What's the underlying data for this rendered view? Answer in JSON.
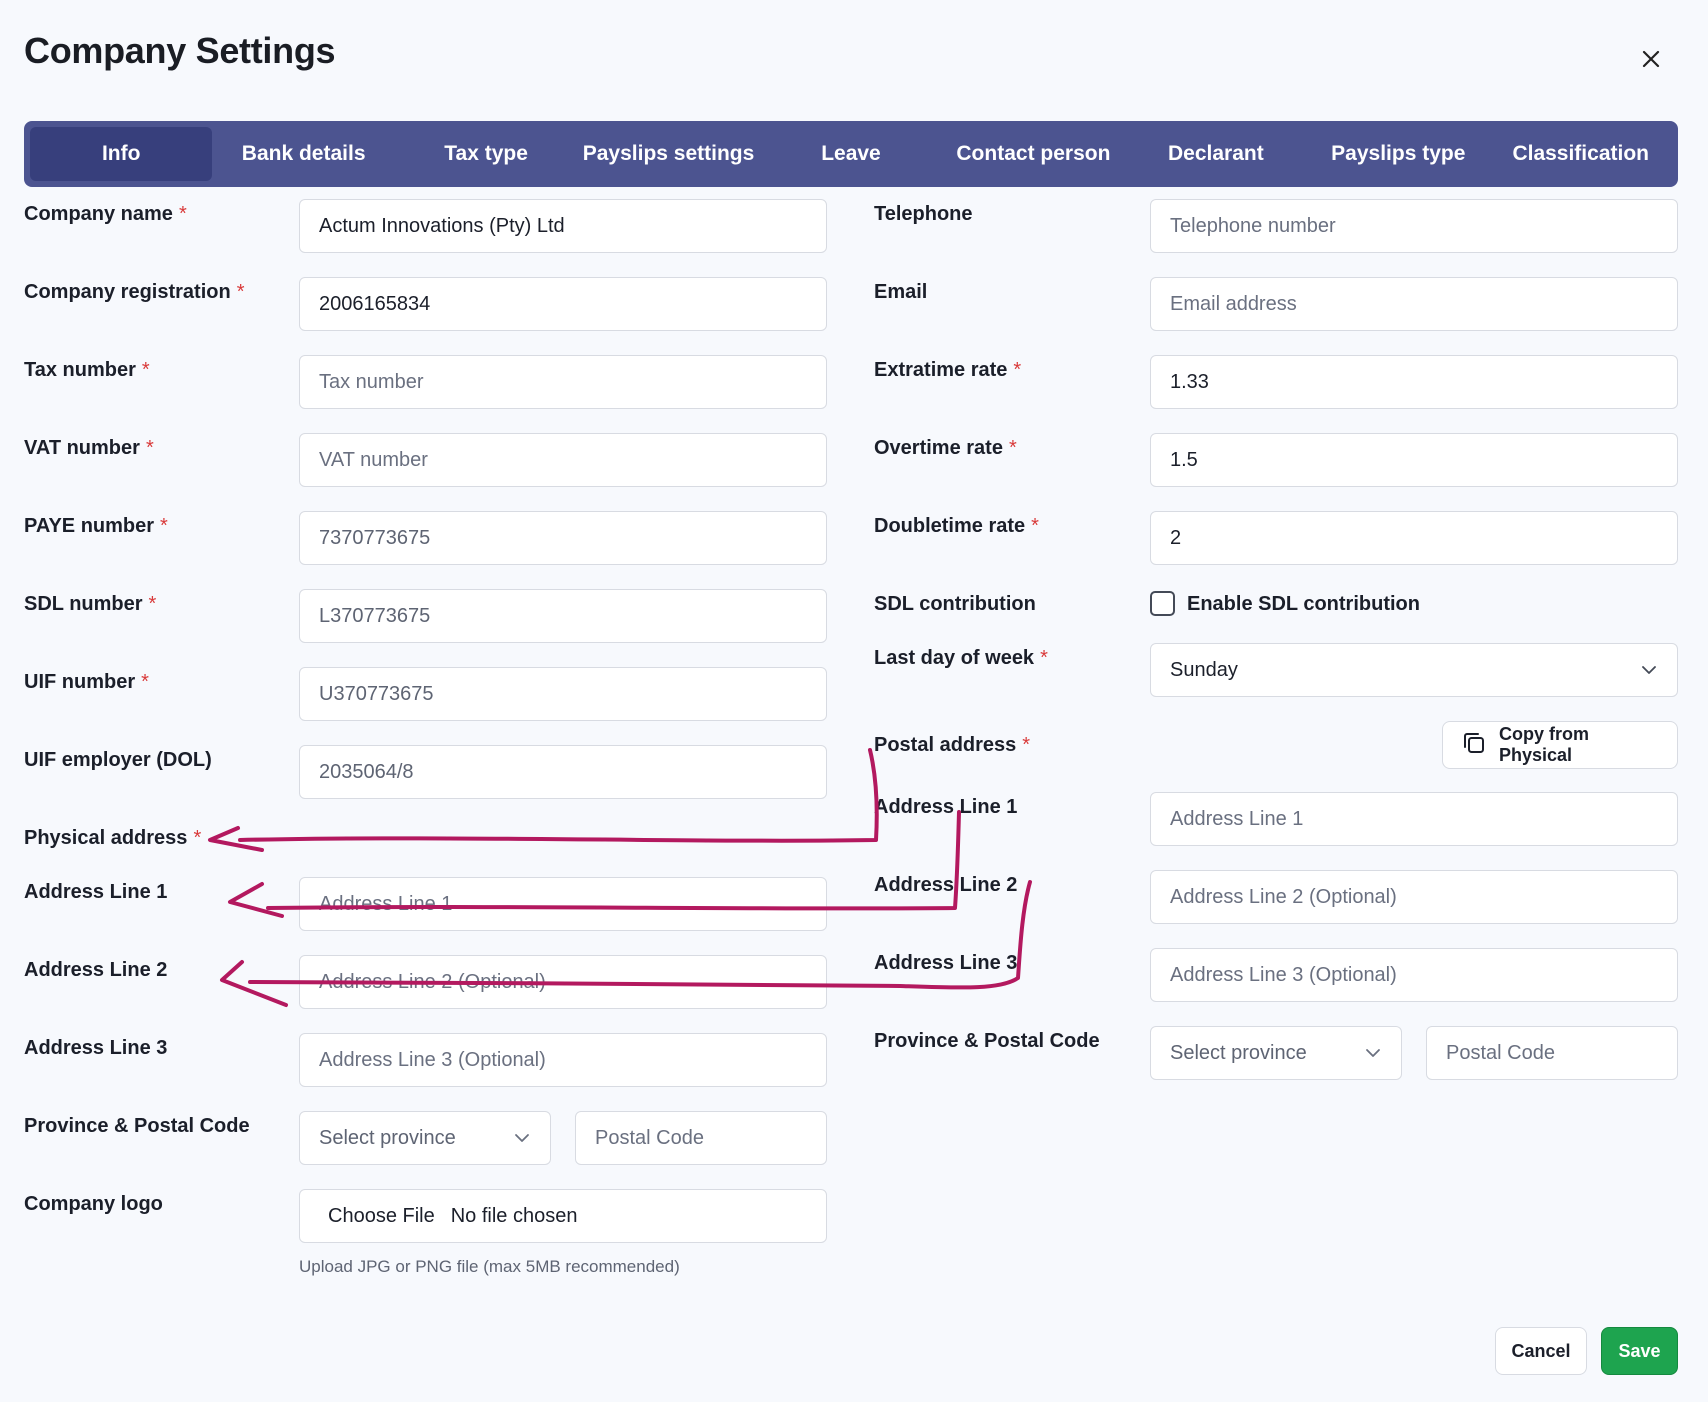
{
  "title": "Company Settings",
  "tabs": [
    {
      "label": "Info",
      "active": true
    },
    {
      "label": "Bank details"
    },
    {
      "label": "Tax type"
    },
    {
      "label": "Payslips settings"
    },
    {
      "label": "Leave"
    },
    {
      "label": "Contact person"
    },
    {
      "label": "Declarant"
    },
    {
      "label": "Payslips type"
    },
    {
      "label": "Classification"
    }
  ],
  "left": {
    "company_name": {
      "label": "Company name",
      "value": "Actum Innovations (Pty) Ltd"
    },
    "company_registration": {
      "label": "Company registration",
      "value": "2006165834"
    },
    "tax_number": {
      "label": "Tax number",
      "placeholder": "Tax number"
    },
    "vat_number": {
      "label": "VAT number",
      "placeholder": "VAT number"
    },
    "paye_number": {
      "label": "PAYE number",
      "value": "7370773675"
    },
    "sdl_number": {
      "label": "SDL number",
      "value": "L370773675"
    },
    "uif_number": {
      "label": "UIF number",
      "value": "U370773675"
    },
    "uif_employer": {
      "label": "UIF employer (DOL)",
      "value": "2035064/8"
    },
    "physical_address": {
      "label": "Physical address"
    },
    "address_line_1": {
      "label": "Address Line 1",
      "placeholder": "Address Line 1"
    },
    "address_line_2": {
      "label": "Address Line 2",
      "placeholder": "Address Line 2 (Optional)"
    },
    "address_line_3": {
      "label": "Address Line 3",
      "placeholder": "Address Line 3 (Optional)"
    },
    "province_postal": {
      "label": "Province & Postal Code",
      "province_placeholder": "Select province",
      "postal_placeholder": "Postal Code"
    },
    "company_logo": {
      "label": "Company logo",
      "button": "Choose File",
      "status": "No file chosen",
      "hint": "Upload JPG or PNG file (max 5MB recommended)"
    }
  },
  "right": {
    "telephone": {
      "label": "Telephone",
      "placeholder": "Telephone number"
    },
    "email": {
      "label": "Email",
      "placeholder": "Email address"
    },
    "extratime_rate": {
      "label": "Extratime rate",
      "value": "1.33"
    },
    "overtime_rate": {
      "label": "Overtime rate",
      "value": "1.5"
    },
    "doubletime_rate": {
      "label": "Doubletime rate",
      "value": "2"
    },
    "sdl_contribution": {
      "label": "SDL contribution",
      "checkbox_label": "Enable SDL contribution",
      "checked": false
    },
    "last_day_of_week": {
      "label": "Last day of week",
      "value": "Sunday"
    },
    "postal_address": {
      "label": "Postal address",
      "copy_button": "Copy from Physical"
    },
    "address_line_1": {
      "label": "Address Line 1",
      "placeholder": "Address Line 1"
    },
    "address_line_2": {
      "label": "Address Line 2",
      "placeholder": "Address Line 2 (Optional)"
    },
    "address_line_3": {
      "label": "Address Line 3",
      "placeholder": "Address Line 3 (Optional)"
    },
    "province_postal": {
      "label": "Province & Postal Code",
      "province_placeholder": "Select province",
      "postal_placeholder": "Postal Code"
    }
  },
  "footer": {
    "cancel": "Cancel",
    "save": "Save"
  },
  "icons": {
    "close": "close-icon",
    "copy": "copy-icon",
    "chevron": "chevron-down-icon"
  },
  "colors": {
    "tab_bar": "#4c5490",
    "tab_active": "#373f7c",
    "required": "#d93a3a",
    "save": "#1ea44f",
    "annotation": "#b3195f"
  }
}
